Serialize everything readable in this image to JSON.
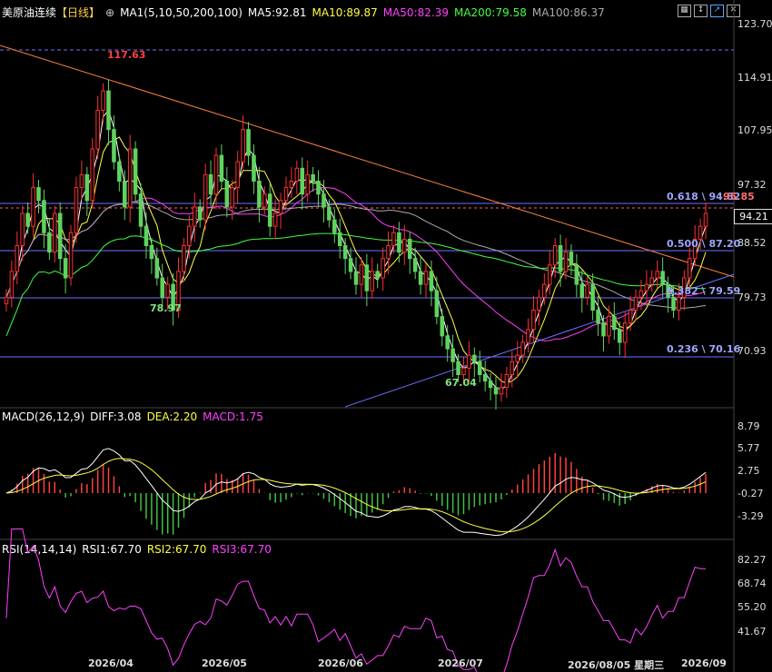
{
  "header": {
    "symbol": "美原油连续",
    "period": "【日线】",
    "ma_group": "MA1(5,10,50,200,100)",
    "ma5": "MA5:92.81",
    "ma10": "MA10:89.87",
    "ma50": "MA50:82.39",
    "ma200": "MA200:79.58",
    "ma100": "MA100:86.37"
  },
  "macd_header": {
    "name": "MACD(26,12,9)",
    "diff": "DIFF:3.08",
    "dea": "DEA:2.20",
    "macd": "MACD:1.75"
  },
  "rsi_header": {
    "name": "RSI(14,14,14)",
    "rsi1": "RSI1:67.70",
    "rsi2": "RSI2:67.70",
    "rsi3": "RSI3:67.70"
  },
  "price_axis": [
    "123.70",
    "114.91",
    "107.95",
    "97.32",
    "88.52",
    "79.73",
    "70.93"
  ],
  "current_price": "94.21",
  "macd_axis": [
    "8.79",
    "5.77",
    "2.75",
    "-0.27",
    "-3.29"
  ],
  "rsi_axis": [
    "82.27",
    "68.74",
    "55.20",
    "41.67"
  ],
  "x_axis": [
    "2026/04",
    "2026/05",
    "2026/06",
    "2026/07",
    "2026/08/05 星期三",
    "2026/09"
  ],
  "annotations": {
    "high": "117.63",
    "low1": "78.97",
    "low2": "67.04",
    "fib618": "0.618 \\ 94.82",
    "fib618b": "95.85",
    "fib500": "0.500 \\ 87.20",
    "fib382": "0.382 \\ 79.59",
    "fib236": "0.236 \\ 70.16"
  },
  "colors": {
    "up": "#ff4040",
    "down": "#54ffff",
    "candle_up": "#ff3030",
    "candle_down": "#5fd35f",
    "ma5": "#ffffff",
    "ma10": "#ffff40",
    "ma50": "#ff40ff",
    "ma200": "#40ff40",
    "ma100": "#aaaaaa",
    "trend_down": "#ff8040",
    "trend_up": "#7070ff",
    "fib": "#7070ff"
  },
  "chart_data": {
    "type": "candlestick",
    "ylim": [
      65,
      125
    ],
    "close": [
      82,
      86,
      90,
      95,
      93,
      99,
      97,
      92,
      89,
      95,
      88,
      85,
      92,
      99,
      101,
      97,
      105,
      111,
      114,
      108,
      103,
      100,
      96,
      105,
      98,
      93,
      90,
      88,
      85,
      82,
      84,
      80,
      86,
      90,
      93,
      96,
      94,
      101,
      98,
      104,
      100,
      96,
      99,
      103,
      108,
      104,
      100,
      96,
      98,
      93,
      95,
      97,
      99,
      100,
      102,
      98,
      101,
      100,
      98,
      96,
      94,
      92,
      90,
      88,
      86,
      84,
      87,
      83,
      86,
      85,
      88,
      90,
      92,
      89,
      91,
      88,
      86,
      84,
      86,
      83,
      79,
      76,
      74,
      72,
      70,
      71,
      73,
      72,
      70,
      69,
      68,
      67,
      68,
      70,
      72,
      73,
      75,
      77,
      80,
      82,
      84,
      87,
      90,
      86,
      89,
      87,
      84,
      82,
      84,
      80,
      78,
      76,
      79,
      77,
      75,
      78,
      80,
      82,
      83,
      84,
      85,
      86,
      84,
      82,
      80,
      82,
      85,
      88,
      91,
      93,
      95
    ],
    "ma_note": ""
  }
}
